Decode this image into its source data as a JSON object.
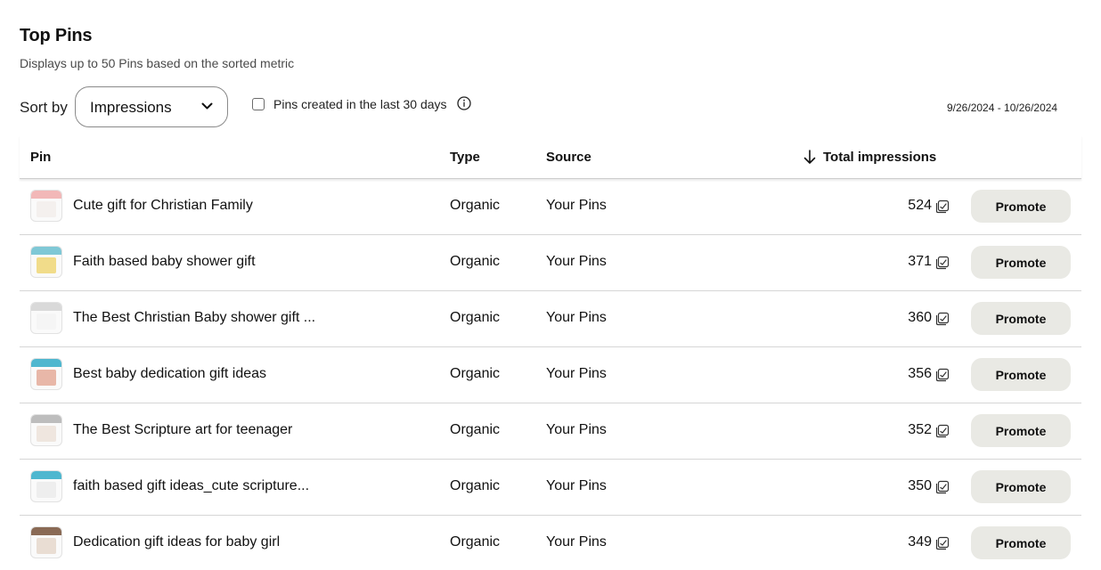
{
  "header": {
    "title": "Top Pins",
    "subtitle": "Displays up to 50 Pins based on the sorted metric"
  },
  "controls": {
    "sort_label": "Sort by",
    "sort_value": "Impressions",
    "checkbox_label": "Pins created in the last 30 days",
    "checkbox_checked": false,
    "date_range": "9/26/2024 - 10/26/2024"
  },
  "table": {
    "columns": {
      "pin": "Pin",
      "type": "Type",
      "source": "Source",
      "total": "Total impressions"
    },
    "promote_label": "Promote",
    "rows": [
      {
        "title": "Cute gift for Christian Family",
        "type": "Organic",
        "source": "Your Pins",
        "count": "524",
        "thumb_band": "#f2b8b8",
        "thumb_body": "#f4f0ee"
      },
      {
        "title": "Faith based baby shower gift",
        "type": "Organic",
        "source": "Your Pins",
        "count": "371",
        "thumb_band": "#7fc8d6",
        "thumb_body": "#f1dc8a"
      },
      {
        "title": "The Best Christian Baby shower gift ...",
        "type": "Organic",
        "source": "Your Pins",
        "count": "360",
        "thumb_band": "#d9d9d9",
        "thumb_body": "#f5f5f5"
      },
      {
        "title": "Best baby dedication gift ideas",
        "type": "Organic",
        "source": "Your Pins",
        "count": "356",
        "thumb_band": "#4fb7cf",
        "thumb_body": "#e8b7a8"
      },
      {
        "title": "The Best Scripture art for teenager",
        "type": "Organic",
        "source": "Your Pins",
        "count": "352",
        "thumb_band": "#bdbdbd",
        "thumb_body": "#efe6df"
      },
      {
        "title": "faith based gift ideas_cute scripture...",
        "type": "Organic",
        "source": "Your Pins",
        "count": "350",
        "thumb_band": "#4fb7cf",
        "thumb_body": "#eeeeee"
      },
      {
        "title": "Dedication gift ideas for baby girl",
        "type": "Organic",
        "source": "Your Pins",
        "count": "349",
        "thumb_band": "#8a6a55",
        "thumb_body": "#e9ddd3"
      }
    ]
  },
  "icons": {
    "sort_chevron": "chevron-down-icon",
    "info": "info-icon",
    "sort_direction": "arrow-down-icon",
    "count_badge": "impressions-icon"
  }
}
